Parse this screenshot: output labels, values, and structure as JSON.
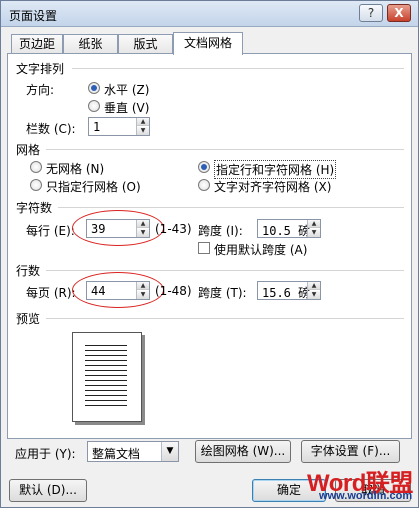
{
  "window": {
    "title": "页面设置",
    "help": "?",
    "close": "X"
  },
  "tabs": [
    "页边距",
    "纸张",
    "版式",
    "文档网格"
  ],
  "text_direction": {
    "title": "文字排列",
    "direction_label": "方向:",
    "horizontal": "水平 (Z)",
    "vertical": "垂直 (V)",
    "columns_label": "栏数 (C):",
    "columns_value": "1"
  },
  "grid": {
    "title": "网格",
    "none": "无网格 (N)",
    "line_only": "只指定行网格 (O)",
    "line_and_char": "指定行和字符网格 (H)",
    "snap_to_char": "文字对齐字符网格 (X)"
  },
  "chars": {
    "title": "字符数",
    "per_line_label": "每行 (E):",
    "per_line_value": "39",
    "per_line_range": "(1-43)",
    "pitch_label": "跨度 (I):",
    "pitch_value": "10.5 磅",
    "default_pitch": "使用默认跨度 (A)"
  },
  "lines": {
    "title": "行数",
    "per_page_label": "每页 (R):",
    "per_page_value": "44",
    "per_page_range": "(1-48)",
    "pitch_label": "跨度 (T):",
    "pitch_value": "15.6 磅"
  },
  "preview": {
    "title": "预览"
  },
  "apply": {
    "label": "应用于 (Y):",
    "value": "整篇文档",
    "draw_grid": "绘图网格 (W)...",
    "font_settings": "字体设置 (F)..."
  },
  "footer": {
    "default": "默认 (D)...",
    "ok": "确定",
    "cancel": "取消"
  },
  "watermark": {
    "main": "Word联盟",
    "sub": "www.wordlm.com"
  },
  "colors": {
    "annotation_oval": "#d9221f",
    "radio_selected": "#2a5fb5",
    "watermark_red": "#d61f21",
    "watermark_blue": "#1a3d8f"
  }
}
